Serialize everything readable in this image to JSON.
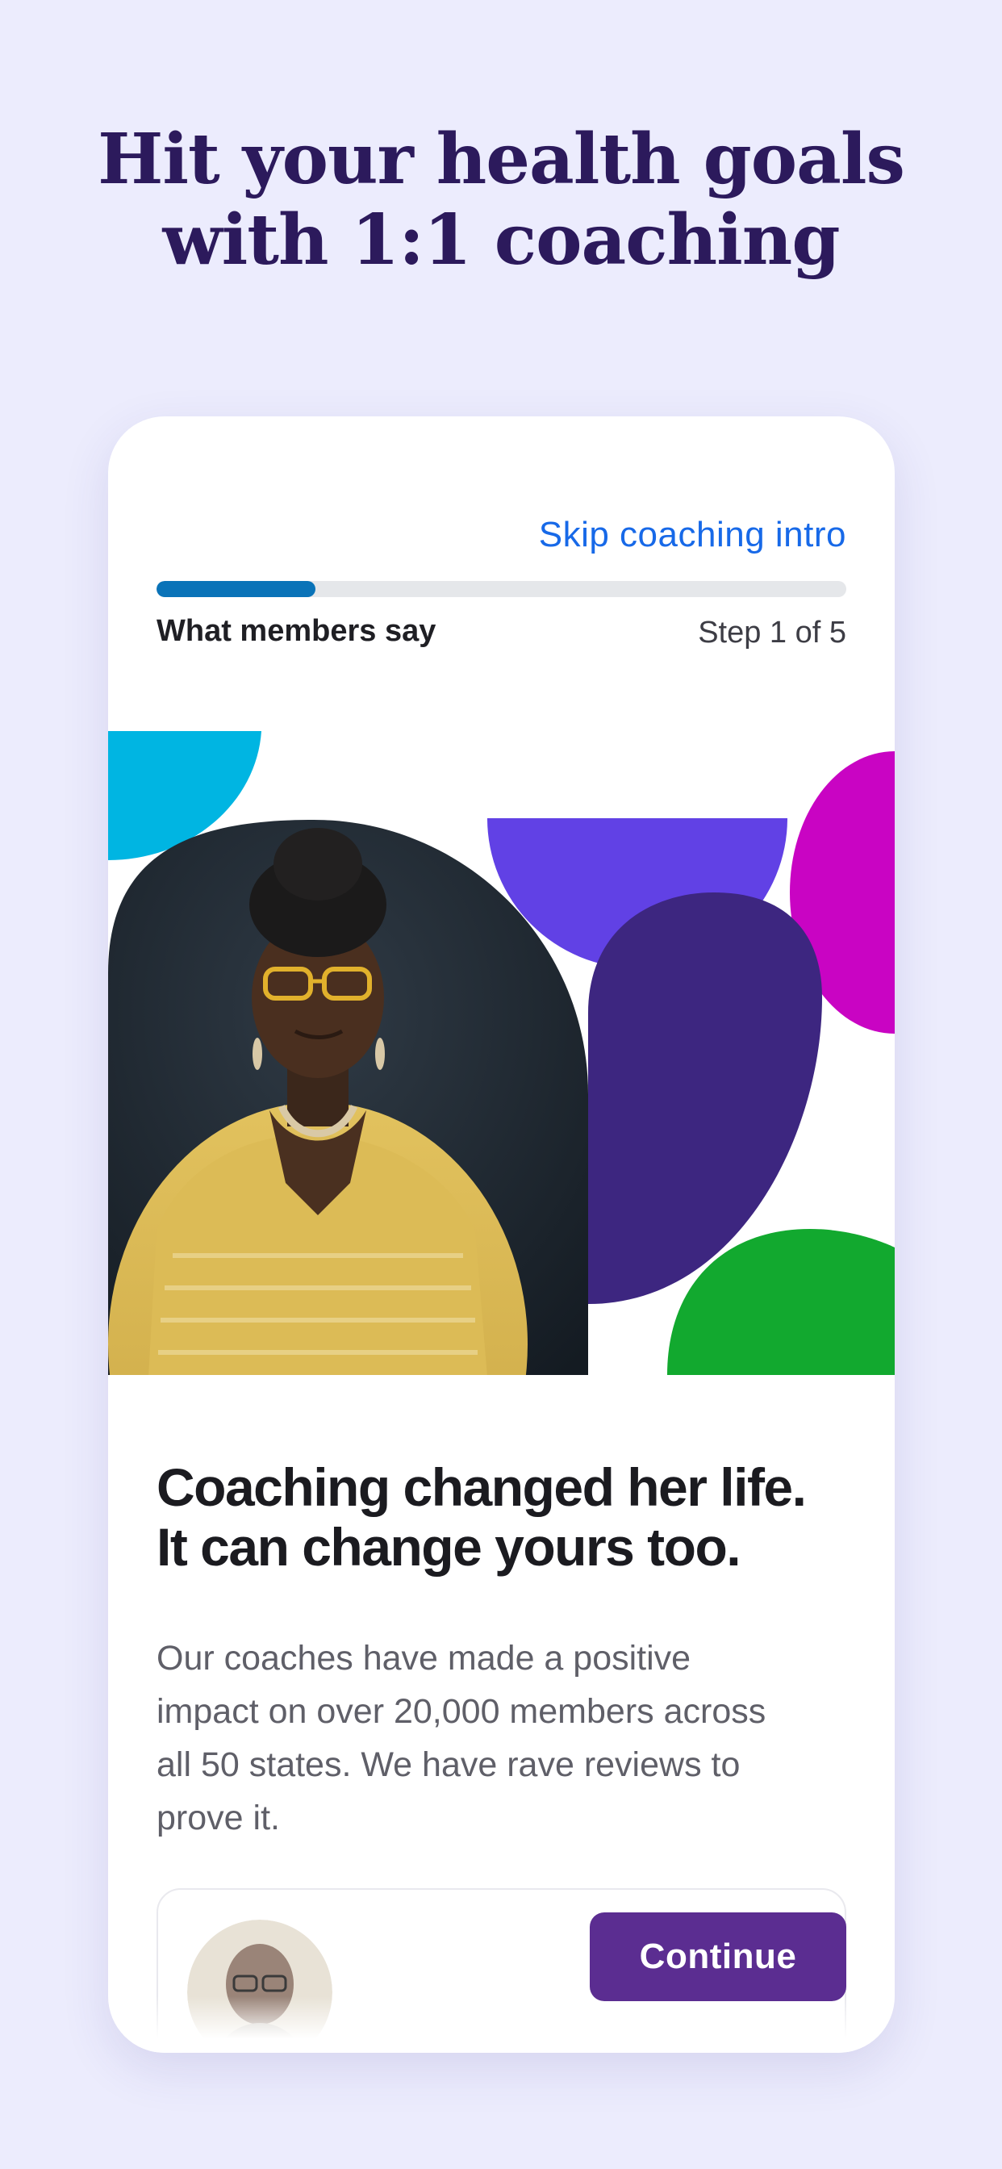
{
  "hero": {
    "title_line1": "Hit your health goals",
    "title_line2": "with 1:1 coaching"
  },
  "header": {
    "skip_label": "Skip coaching intro",
    "step_title": "What members say",
    "step_count": "Step 1 of 5",
    "progress": 0.2
  },
  "content": {
    "headline_line1": "Coaching changed her life.",
    "headline_line2": "It can change yours too.",
    "body": "Our coaches have made a positive impact on over 20,000 members across all 50 states. We have rave reviews to prove it."
  },
  "footer": {
    "continue_label": "Continue"
  },
  "colors": {
    "background": "#ececfd",
    "title": "#2c1a5c",
    "link": "#1769e8",
    "progress": "#0a73b8",
    "button": "#5b2d91",
    "shape_cyan": "#00b5e2",
    "shape_violet": "#6141e5",
    "shape_magenta": "#c904c3",
    "shape_indigo": "#3d2680",
    "shape_green": "#12a92f"
  },
  "icons": {
    "testimonial_photo": "member-portrait",
    "reviewer_avatar": "reviewer-avatar"
  }
}
